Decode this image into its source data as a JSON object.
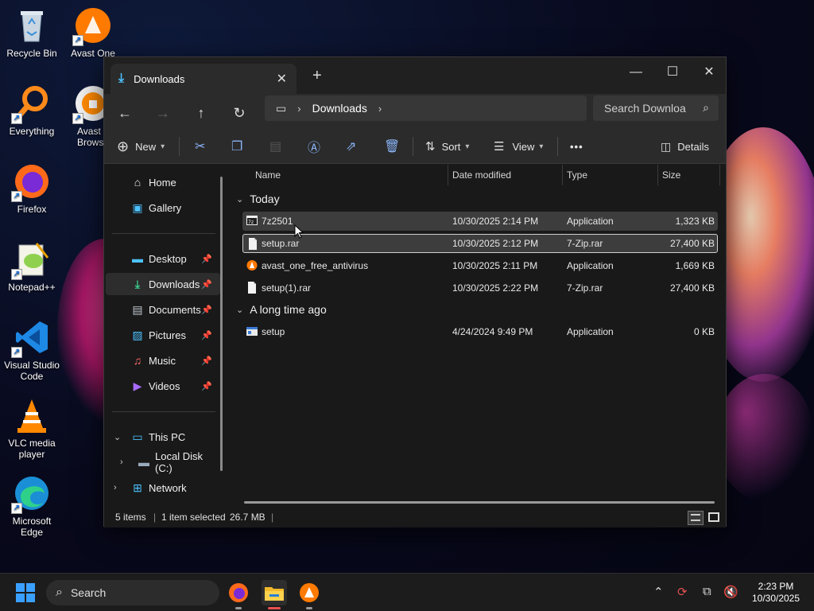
{
  "desktop": {
    "icons": [
      {
        "label": "Recycle Bin"
      },
      {
        "label": "Avast One"
      },
      {
        "label": "Everything"
      },
      {
        "label": "Avast Sec Brows"
      },
      {
        "label": "Firefox"
      },
      {
        "label": "Notepad++"
      },
      {
        "label": "Visual Studio Code"
      },
      {
        "label": "VLC media player"
      },
      {
        "label": "Microsoft Edge"
      }
    ]
  },
  "window": {
    "tab_title": "Downloads",
    "address": {
      "crumbs": [
        "Downloads"
      ]
    },
    "search_placeholder": "Search Downloa",
    "toolbar": {
      "new_label": "New",
      "sort_label": "Sort",
      "view_label": "View",
      "more_label": "•••",
      "details_label": "Details"
    },
    "sidebar": {
      "top": [
        {
          "label": "Home",
          "icon": "home-icon"
        },
        {
          "label": "Gallery",
          "icon": "gallery-icon"
        }
      ],
      "pinned": [
        {
          "label": "Desktop",
          "icon": "desktop-folder-icon"
        },
        {
          "label": "Downloads",
          "icon": "downloads-icon"
        },
        {
          "label": "Documents",
          "icon": "documents-icon"
        },
        {
          "label": "Pictures",
          "icon": "pictures-icon"
        },
        {
          "label": "Music",
          "icon": "music-icon"
        },
        {
          "label": "Videos",
          "icon": "videos-icon"
        }
      ],
      "tree": [
        {
          "label": "This PC",
          "icon": "pc-icon"
        },
        {
          "label": "Local Disk (C:)",
          "icon": "drive-icon"
        },
        {
          "label": "Network",
          "icon": "network-icon"
        }
      ]
    },
    "columns": [
      "Name",
      "Date modified",
      "Type",
      "Size"
    ],
    "groups": [
      {
        "title": "Today",
        "files": [
          {
            "name": "7z2501",
            "date": "10/30/2025 2:14 PM",
            "type": "Application",
            "size": "1,323 KB"
          },
          {
            "name": "setup.rar",
            "date": "10/30/2025 2:12 PM",
            "type": "7-Zip.rar",
            "size": "27,400 KB"
          },
          {
            "name": "avast_one_free_antivirus",
            "date": "10/30/2025 2:11 PM",
            "type": "Application",
            "size": "1,669 KB"
          },
          {
            "name": "setup(1).rar",
            "date": "10/30/2025 2:22 PM",
            "type": "7-Zip.rar",
            "size": "27,400 KB"
          }
        ]
      },
      {
        "title": "A long time ago",
        "files": [
          {
            "name": "setup",
            "date": "4/24/2024 9:49 PM",
            "type": "Application",
            "size": "0 KB"
          }
        ]
      }
    ],
    "status": {
      "items": "5 items",
      "selection": "1 item selected",
      "size": "26.7 MB"
    }
  },
  "taskbar": {
    "search_label": "Search",
    "time": "2:23 PM",
    "date": "10/30/2025"
  },
  "colors": {
    "accent": "#4cc2ff",
    "window_bg": "#191919",
    "toolbar_bg": "#2b2b2b",
    "selection_bg": "#3d3d3d"
  }
}
